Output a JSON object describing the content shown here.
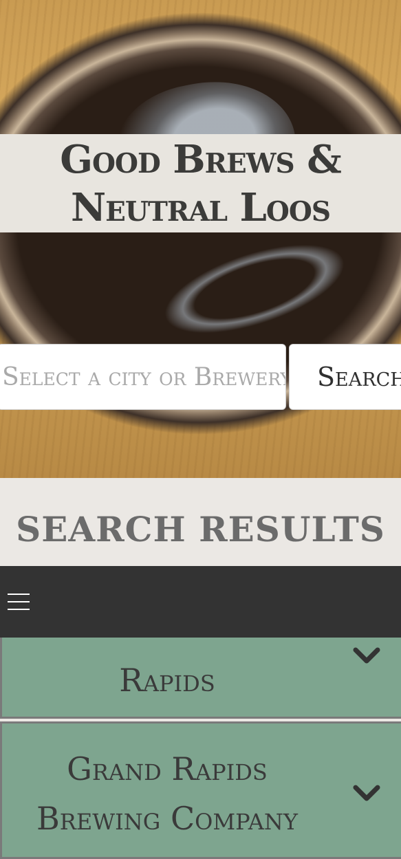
{
  "header": {
    "title_line1": "Good Brews &",
    "title_line2": "Neutral Loos"
  },
  "search": {
    "placeholder": "Select a city or Brewery",
    "button_label": "Search"
  },
  "results": {
    "heading": "SEARCH RESULTS",
    "items": [
      {
        "title_partial": "Grand Rapids",
        "title_visible": "Rapids"
      },
      {
        "title_line1": "Grand Rapids",
        "title_line2": "Brewing Company"
      }
    ]
  },
  "nav": {
    "menu_icon": "hamburger-menu-icon"
  },
  "icons": {
    "expand": "chevron-down-icon"
  },
  "colors": {
    "card_green": "#7ea58f",
    "navbar": "#333333",
    "title_band": "#e8e5df"
  }
}
